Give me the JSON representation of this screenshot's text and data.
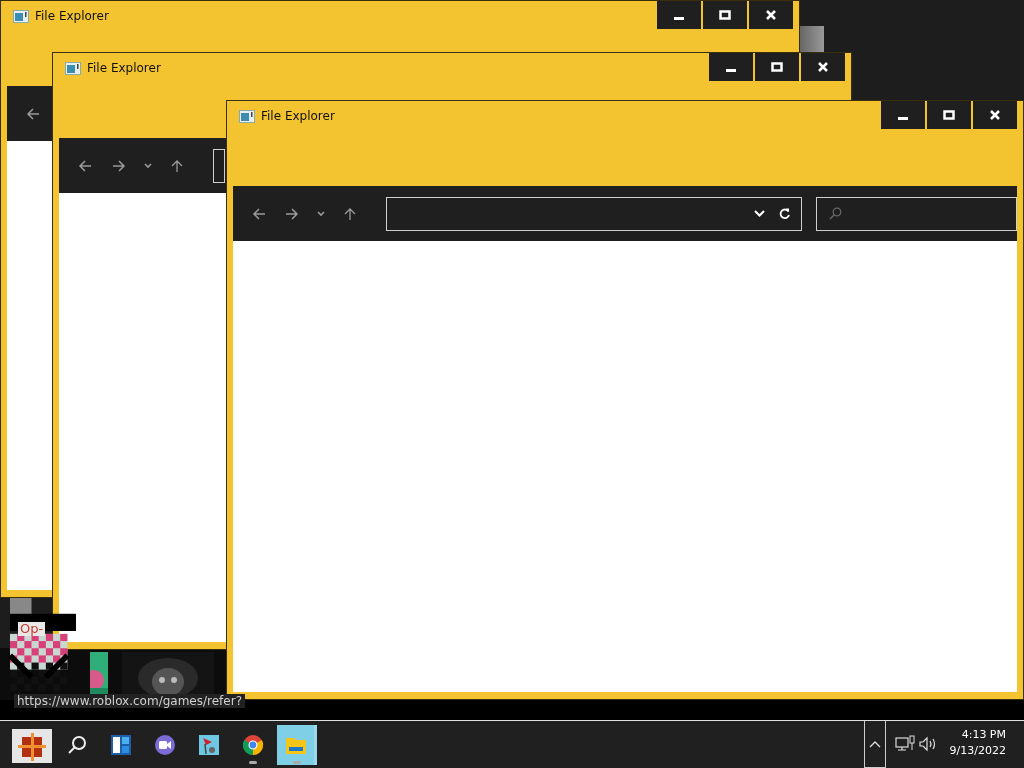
{
  "windows": [
    {
      "title": "File Explorer",
      "toolbar": [
        {
          "kind": "back"
        }
      ]
    },
    {
      "title": "File Explorer",
      "toolbar": [
        {
          "kind": "back"
        },
        {
          "kind": "forward"
        },
        {
          "kind": "recent"
        },
        {
          "kind": "up"
        },
        {
          "kind": "address"
        }
      ]
    },
    {
      "title": "File Explorer",
      "toolbar": [
        {
          "kind": "back"
        },
        {
          "kind": "forward"
        },
        {
          "kind": "recent"
        },
        {
          "kind": "up"
        },
        {
          "kind": "address"
        },
        {
          "kind": "search"
        }
      ]
    }
  ],
  "browser_fragment": {
    "label": "Op-",
    "link_preview": "https://www.roblox.com/games/refer?"
  },
  "taskbar": {
    "apps": [
      {
        "kind": "search",
        "selected": false,
        "running": false
      },
      {
        "kind": "widgets",
        "selected": false,
        "running": false
      },
      {
        "kind": "chat",
        "selected": false,
        "running": false
      },
      {
        "kind": "app",
        "selected": false,
        "running": false
      },
      {
        "kind": "chrome",
        "selected": false,
        "running": true
      },
      {
        "kind": "explorer",
        "selected": true,
        "running": true
      }
    ],
    "clock": {
      "time": "4:13 PM",
      "date": "9/13/2022"
    }
  }
}
